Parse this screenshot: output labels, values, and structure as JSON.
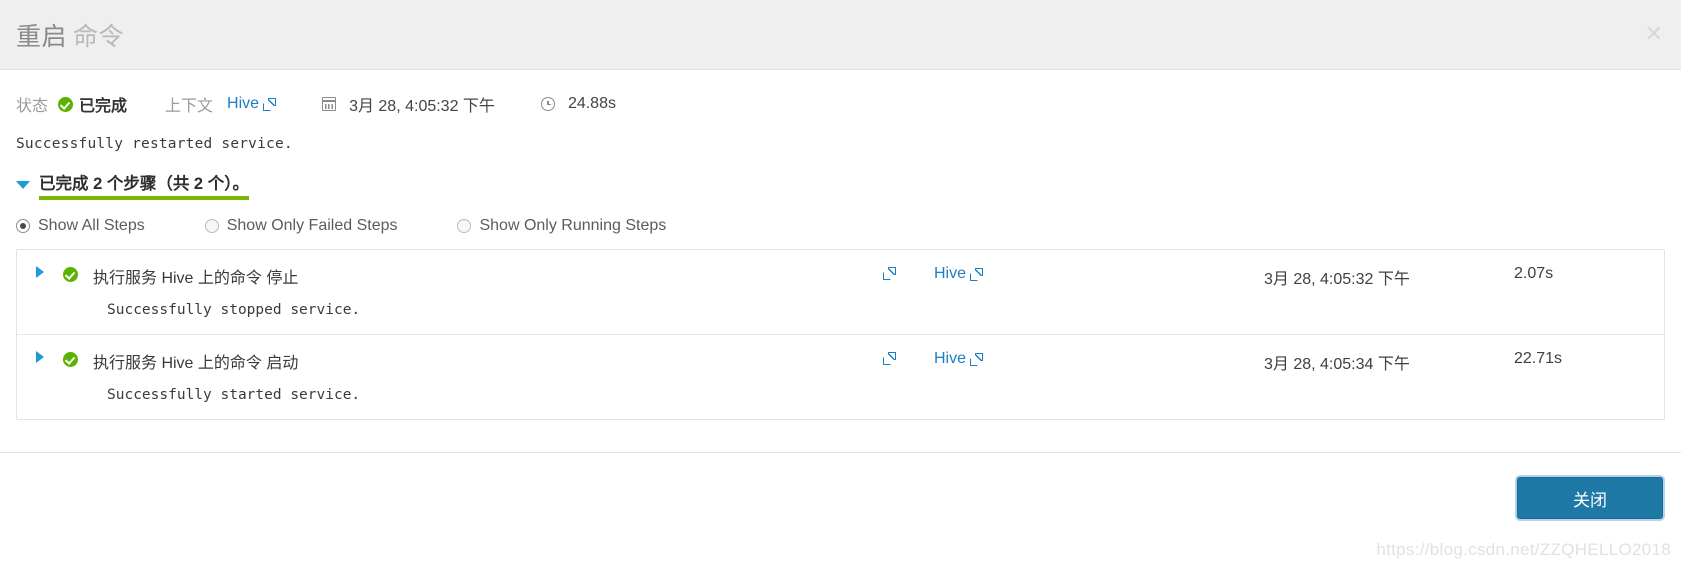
{
  "header": {
    "title_primary": "重启",
    "title_secondary": "命令",
    "close_icon": "close-icon"
  },
  "status_bar": {
    "status_label": "状态",
    "status_value": "已完成",
    "context_label": "上下文",
    "context_link": "Hive",
    "calendar_icon": "calendar-icon",
    "timestamp": "3月 28, 4:05:32 下午",
    "clock_icon": "clock-icon",
    "duration": "24.88s"
  },
  "result_message": "Successfully restarted service.",
  "steps_summary": {
    "chevron_icon": "chevron-down-icon",
    "text": "已完成 2 个步骤（共 2 个）。",
    "progress_color": "#7ab800"
  },
  "filters": [
    {
      "label": "Show All Steps",
      "checked": true
    },
    {
      "label": "Show Only Failed Steps",
      "checked": false
    },
    {
      "label": "Show Only Running Steps",
      "checked": false
    }
  ],
  "steps": [
    {
      "title": "执行服务 Hive 上的命令 停止",
      "message": "Successfully stopped service.",
      "context": "Hive",
      "time": "3月 28, 4:05:32 下午",
      "duration": "2.07s"
    },
    {
      "title": "执行服务 Hive 上的命令 启动",
      "message": "Successfully started service.",
      "context": "Hive",
      "time": "3月 28, 4:05:34 下午",
      "duration": "22.71s"
    }
  ],
  "footer": {
    "close_button": "关闭"
  },
  "watermark": "https://blog.csdn.net/ZZQHELLO2018",
  "colors": {
    "accent_blue": "#1b7fc3",
    "button_blue": "#1f79a7",
    "success_green": "#5cb200",
    "progress_green": "#7ab800"
  }
}
